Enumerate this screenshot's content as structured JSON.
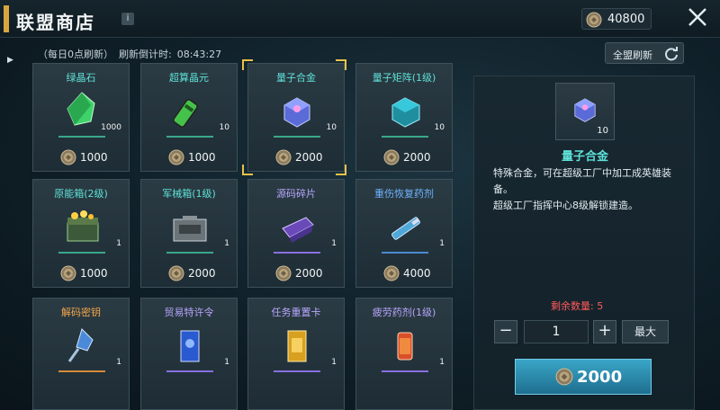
{
  "header": {
    "title": "联盟商店",
    "info_label": "i",
    "currency_amount": "40800"
  },
  "refresh": {
    "daily_note": "（每日0点刷新）",
    "countdown_label": "刷新倒计时:",
    "countdown_value": "08:43:27",
    "refresh_all_label": "全盟刷新"
  },
  "items": [
    {
      "name": "绿晶石",
      "qty": "1000",
      "price": "1000",
      "color": "#5ee0d8",
      "icon": "green-crystal-icon"
    },
    {
      "name": "超算晶元",
      "qty": "10",
      "price": "1000",
      "color": "#5ee0d8",
      "icon": "green-chip-icon"
    },
    {
      "name": "量子合金",
      "qty": "10",
      "price": "2000",
      "color": "#5ee0d8",
      "icon": "quantum-alloy-icon"
    },
    {
      "name": "量子矩阵(1级)",
      "qty": "10",
      "price": "2000",
      "color": "#5ee0d8",
      "icon": "quantum-matrix-icon"
    },
    {
      "name": "原能箱(2级)",
      "qty": "1",
      "price": "1000",
      "color": "#5ee0d8",
      "icon": "energy-chest-icon"
    },
    {
      "name": "军械箱(1级)",
      "qty": "1",
      "price": "2000",
      "color": "#5ee0d8",
      "icon": "arms-chest-icon"
    },
    {
      "name": "源码碎片",
      "qty": "1",
      "price": "2000",
      "color": "#b8a6ff",
      "icon": "code-fragment-icon"
    },
    {
      "name": "重伤恢复药剂",
      "qty": "1",
      "price": "4000",
      "color": "#6fb4ff",
      "icon": "syringe-icon"
    },
    {
      "name": "解码密钥",
      "qty": "1",
      "price": "",
      "color": "#f2a54a",
      "icon": "decode-key-icon"
    },
    {
      "name": "贸易特许令",
      "qty": "1",
      "price": "",
      "color": "#b8a6ff",
      "icon": "trade-permit-icon"
    },
    {
      "name": "任务重置卡",
      "qty": "1",
      "price": "",
      "color": "#b8a6ff",
      "icon": "reset-card-icon"
    },
    {
      "name": "疲劳药剂(1级)",
      "qty": "1",
      "price": "",
      "color": "#b8a6ff",
      "icon": "fatigue-potion-icon"
    }
  ],
  "detail": {
    "name": "量子合金",
    "qty": "10",
    "desc_line1": "特殊合金，可在超级工厂中加工成英雄装备。",
    "desc_line2": "超级工厂指挥中心8级解锁建造。",
    "remain_label": "剩余数量: 5",
    "quantity_value": "1",
    "minus_label": "−",
    "plus_label": "+",
    "max_label": "最大",
    "buy_price": "2000"
  }
}
